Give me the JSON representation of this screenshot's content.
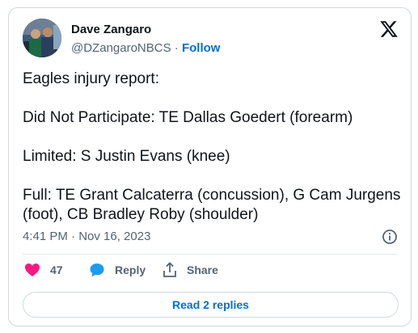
{
  "author": {
    "name": "Dave Zangaro",
    "handle": "@DZangaroNBCS",
    "separator": " · ",
    "follow_label": "Follow"
  },
  "tweet": {
    "lines": [
      "Eagles injury report:",
      "Did Not Participate: TE Dallas Goedert (forearm)",
      "Limited: S Justin Evans (knee)",
      "Full: TE Grant Calcaterra (concussion), G Cam Jurgens (foot), CB Bradley Roby (shoulder)"
    ],
    "timestamp": "4:41 PM · Nov 16, 2023"
  },
  "actions": {
    "like_count": "47",
    "reply_label": "Reply",
    "share_label": "Share"
  },
  "read_replies_label": "Read 2 replies",
  "colors": {
    "like": "#f91880",
    "reply": "#1d9bf0",
    "link": "#006fd6",
    "muted": "#536471"
  },
  "icons": [
    "x-logo-icon",
    "info-icon",
    "heart-icon",
    "reply-bubble-icon",
    "share-icon"
  ]
}
